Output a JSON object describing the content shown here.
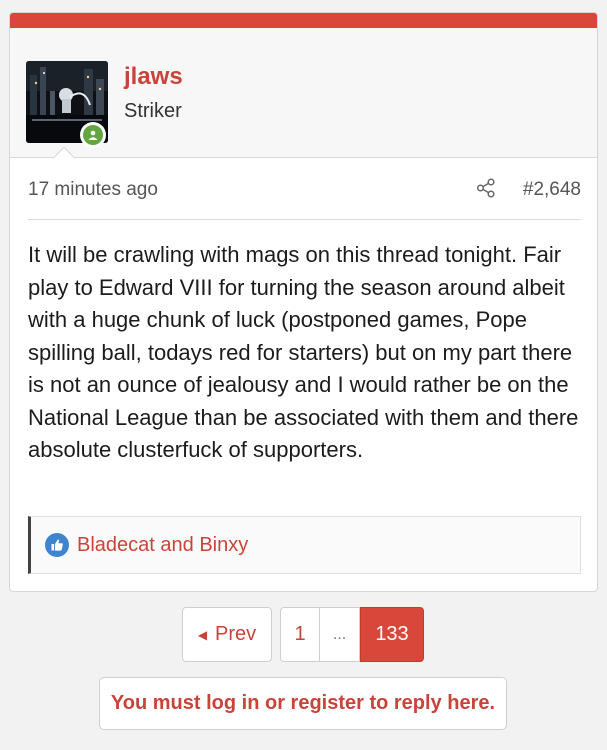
{
  "post": {
    "user": {
      "name": "jlaws",
      "title": "Striker",
      "status": "online"
    },
    "time": "17 minutes ago",
    "post_number": "#2,648",
    "message": "It will be crawling with mags on this thread tonight. Fair play to Edward VIII for turning the season around albeit with a huge chunk of luck (postponed games, Pope spilling ball, todays red for starters) but on my part there is not an ounce of jealousy and I would rather be on the National League than be associated with them and there absolute clusterfuck of supporters.",
    "reactions": {
      "icon": "thumbs-up-icon",
      "text": "Bladecat and Binxy"
    }
  },
  "pagination": {
    "prev_label": "Prev",
    "first_page": "1",
    "ellipsis": "...",
    "current_page": "133"
  },
  "reply": {
    "login_label": "You must log in or register to reply here."
  },
  "colors": {
    "accent": "#d9473a",
    "link": "#c8443a",
    "online": "#63a543",
    "like": "#3e84cf"
  }
}
